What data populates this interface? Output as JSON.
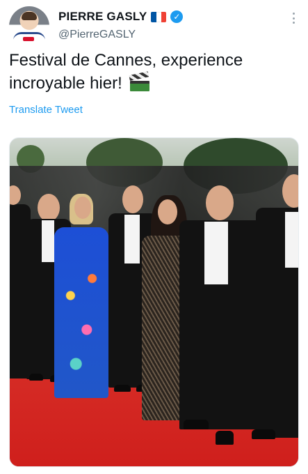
{
  "user": {
    "display_name": "PIERRE GASLY",
    "handle": "@PierreGASLY",
    "flag_colors": [
      "#0055a4",
      "#ffffff",
      "#ef4135"
    ],
    "verified_color": "#1d9bf0"
  },
  "tweet": {
    "text": "Festival de Cannes, experience incroyable hier!",
    "emoji": "clapper-board-icon",
    "translate_label": "Translate Tweet"
  },
  "icons": {
    "verified": "verified-badge-icon",
    "more": "more-options-icon"
  },
  "colors": {
    "link": "#1d9bf0",
    "secondary_text": "#536471",
    "carpet_red": "#d3211f"
  }
}
